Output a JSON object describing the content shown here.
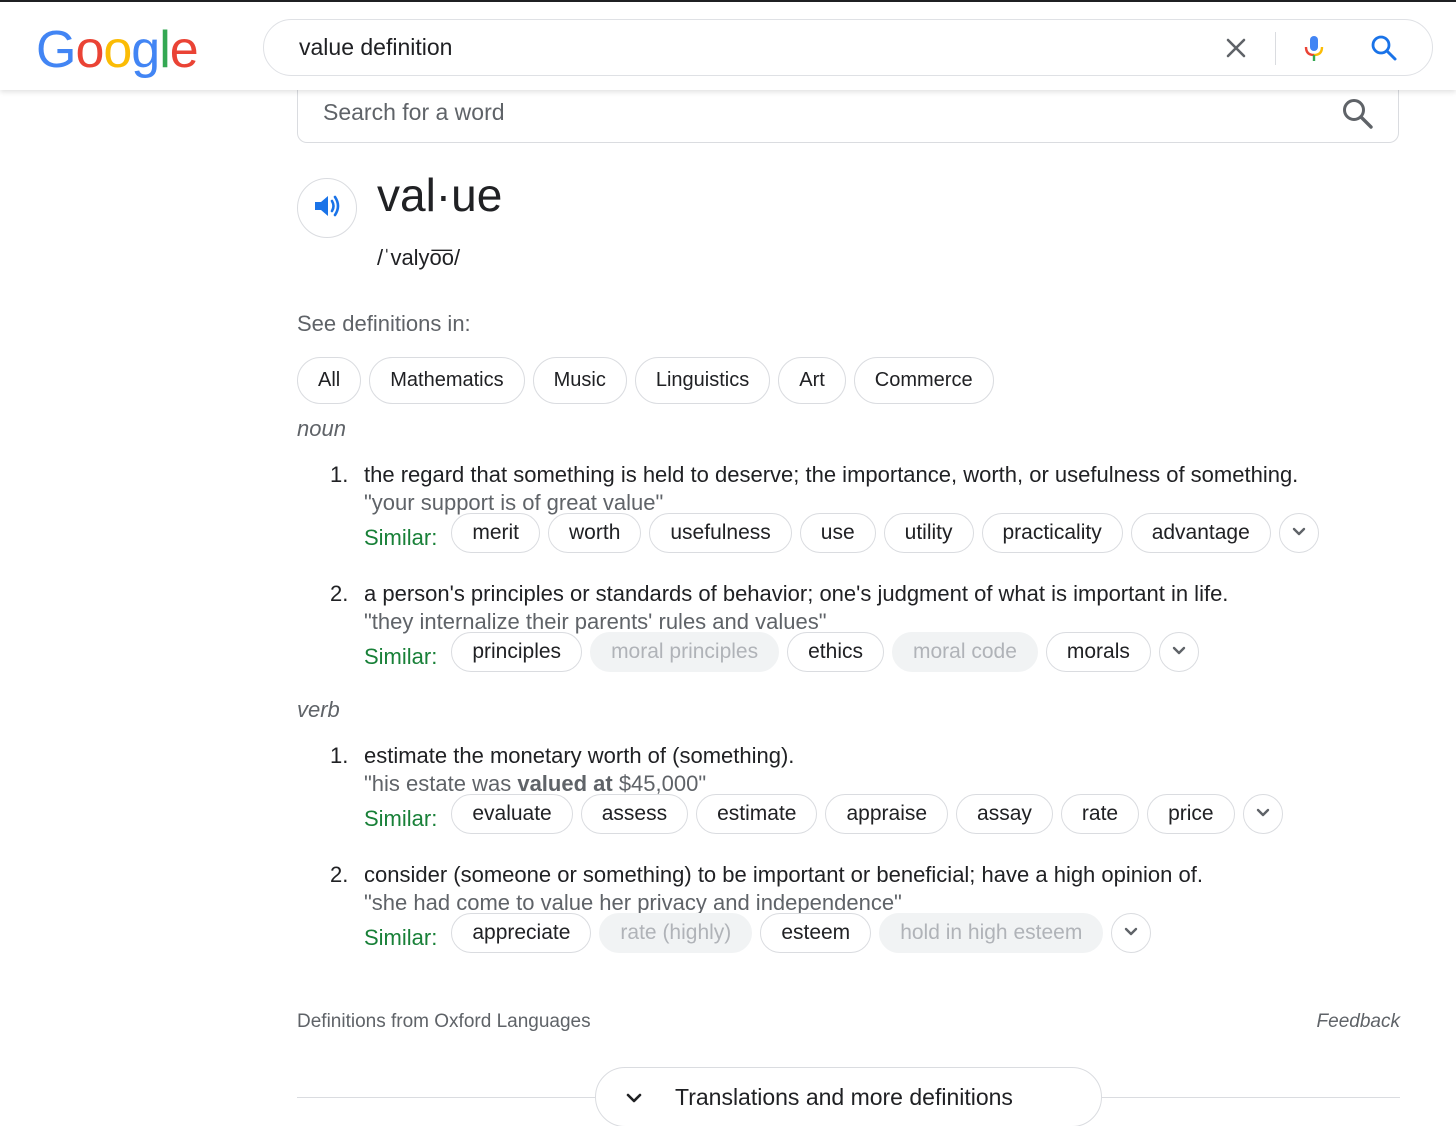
{
  "header": {
    "logo": [
      "G",
      "o",
      "o",
      "g",
      "l",
      "e"
    ],
    "query": "value definition",
    "icons": [
      "clear-icon",
      "microphone-icon",
      "search-icon"
    ]
  },
  "dictionary": {
    "search_placeholder": "Search for a word",
    "word": "val·ue",
    "phonetic": "/ˈvalyo͞o/",
    "see_definitions_label": "See definitions in:",
    "categories": [
      "All",
      "Mathematics",
      "Music",
      "Linguistics",
      "Art",
      "Commerce"
    ],
    "similar_label": "Similar:",
    "noun": {
      "label": "noun",
      "senses": [
        {
          "num": "1.",
          "definition": "the regard that something is held to deserve; the importance, worth, or usefulness of something.",
          "example": "\"your support is of great value\"",
          "similar": [
            {
              "text": "merit",
              "muted": false
            },
            {
              "text": "worth",
              "muted": false
            },
            {
              "text": "usefulness",
              "muted": false
            },
            {
              "text": "use",
              "muted": false
            },
            {
              "text": "utility",
              "muted": false
            },
            {
              "text": "practicality",
              "muted": false
            },
            {
              "text": "advantage",
              "muted": false
            }
          ]
        },
        {
          "num": "2.",
          "definition": "a person's principles or standards of behavior; one's judgment of what is important in life.",
          "example": "\"they internalize their parents' rules and values\"",
          "similar": [
            {
              "text": "principles",
              "muted": false
            },
            {
              "text": "moral principles",
              "muted": true
            },
            {
              "text": "ethics",
              "muted": false
            },
            {
              "text": "moral code",
              "muted": true
            },
            {
              "text": "morals",
              "muted": false
            }
          ]
        }
      ]
    },
    "verb": {
      "label": "verb",
      "senses": [
        {
          "num": "1.",
          "definition": "estimate the monetary worth of (something).",
          "example_pre": "\"his estate was ",
          "example_bold": "valued at",
          "example_post": " $45,000\"",
          "similar": [
            {
              "text": "evaluate",
              "muted": false
            },
            {
              "text": "assess",
              "muted": false
            },
            {
              "text": "estimate",
              "muted": false
            },
            {
              "text": "appraise",
              "muted": false
            },
            {
              "text": "assay",
              "muted": false
            },
            {
              "text": "rate",
              "muted": false
            },
            {
              "text": "price",
              "muted": false
            }
          ]
        },
        {
          "num": "2.",
          "definition": "consider (someone or something) to be important or beneficial; have a high opinion of.",
          "example": "\"she had come to value her privacy and independence\"",
          "similar": [
            {
              "text": "appreciate",
              "muted": false
            },
            {
              "text": "rate (highly)",
              "muted": true
            },
            {
              "text": "esteem",
              "muted": false
            },
            {
              "text": "hold in high esteem",
              "muted": true
            }
          ]
        }
      ]
    },
    "source": "Definitions from Oxford Languages",
    "feedback": "Feedback",
    "more_button": "Translations and more definitions"
  },
  "colors": {
    "logo": [
      "#4285F4",
      "#EA4335",
      "#FBBC05",
      "#4285F4",
      "#34A853",
      "#EA4335"
    ],
    "similar_label": "#188038",
    "muted_chip_bg": "#f1f3f4",
    "accent_blue": "#1a73e8"
  }
}
